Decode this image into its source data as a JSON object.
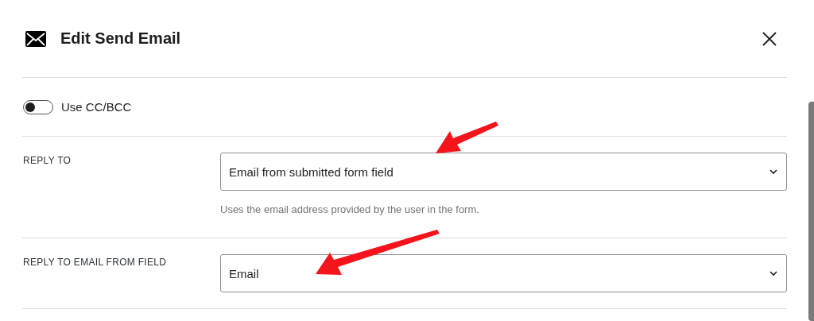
{
  "dialog": {
    "title": "Edit Send Email"
  },
  "toggle": {
    "label": "Use CC/BCC",
    "on": false
  },
  "fields": [
    {
      "label": "REPLY TO",
      "value": "Email from submitted form field",
      "help": "Uses the email address provided by the user in the form."
    },
    {
      "label": "REPLY TO EMAIL FROM FIELD",
      "value": "Email"
    }
  ]
}
